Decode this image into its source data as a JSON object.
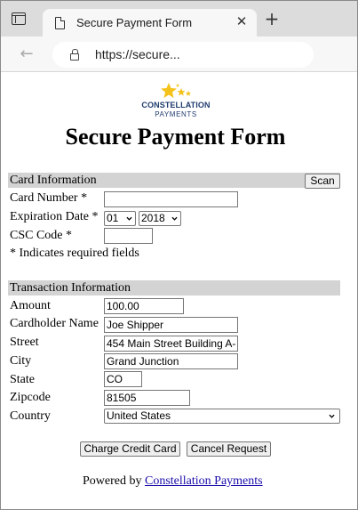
{
  "browser": {
    "tab_title": "Secure Payment Form",
    "url": "https://secure..."
  },
  "logo": {
    "name": "CONSTELLATION",
    "sub": "PAYMENTS",
    "colors": {
      "star": "#f4c21b",
      "text": "#1f3c6e"
    }
  },
  "page_title": "Secure Payment Form",
  "card_section": {
    "header": "Card Information",
    "scan_label": "Scan",
    "card_number_label": "Card Number *",
    "card_number_value": "",
    "expiration_label": "Expiration Date *",
    "exp_month": "01",
    "exp_year": "2018",
    "csc_label": "CSC Code *",
    "csc_value": "",
    "required_note": "* Indicates required fields"
  },
  "transaction_section": {
    "header": "Transaction Information",
    "amount_label": "Amount",
    "amount_value": "100.00",
    "cardholder_label": "Cardholder Name",
    "cardholder_value": "Joe Shipper",
    "street_label": "Street",
    "street_value": "454 Main Street Building A-",
    "city_label": "City",
    "city_value": "Grand Junction",
    "state_label": "State",
    "state_value": "CO",
    "zip_label": "Zipcode",
    "zip_value": "81505",
    "country_label": "Country",
    "country_value": "United States"
  },
  "actions": {
    "charge_label": "Charge Credit Card",
    "cancel_label": "Cancel Request"
  },
  "footer": {
    "powered_prefix": "Powered by",
    "powered_link": "Constellation Payments"
  },
  "colors": {
    "section_bg": "#d3d3d3",
    "link": "#1a0dab"
  }
}
